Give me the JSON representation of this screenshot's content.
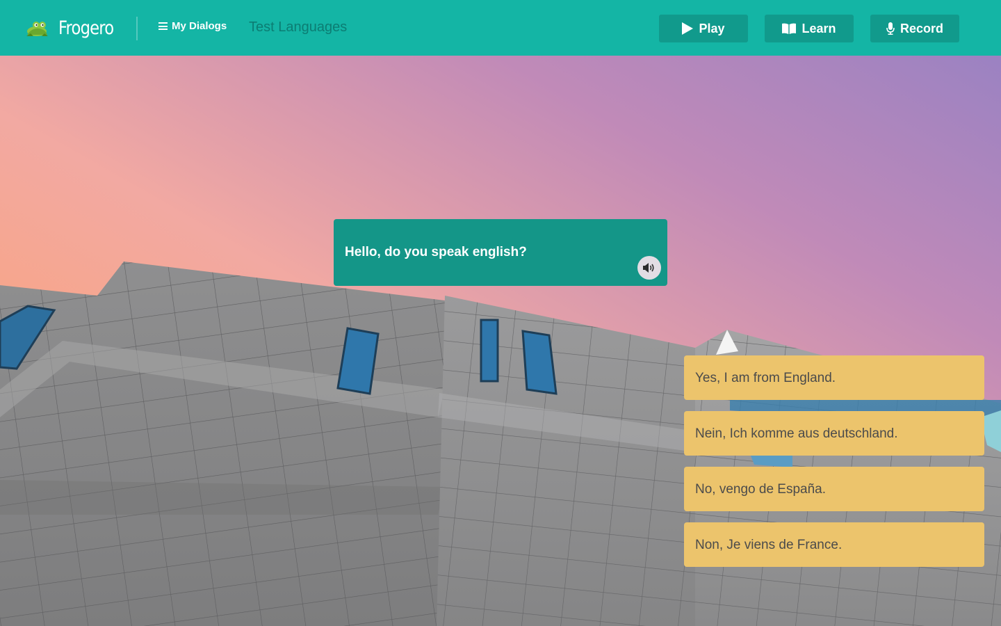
{
  "header": {
    "brand": "Frogero",
    "nav_dialogs": "My Dialogs",
    "page_title": "Test Languages",
    "buttons": {
      "play": "Play",
      "learn": "Learn",
      "record": "Record"
    }
  },
  "dialog": {
    "question": "Hello, do you speak english?",
    "answers": [
      "Yes, I am from England.",
      "Nein, Ich komme aus deutschland.",
      "No, vengo de España.",
      "Non, Je viens de France."
    ]
  },
  "colors": {
    "header": "#14b5a5",
    "button": "#119a8c",
    "question_bubble": "#149688",
    "answer_bubble": "#ecc46c",
    "page_title": "#0c7d73"
  },
  "icons": [
    "frog-logo-icon",
    "menu-icon",
    "play-icon",
    "book-icon",
    "microphone-icon",
    "speaker-icon"
  ]
}
